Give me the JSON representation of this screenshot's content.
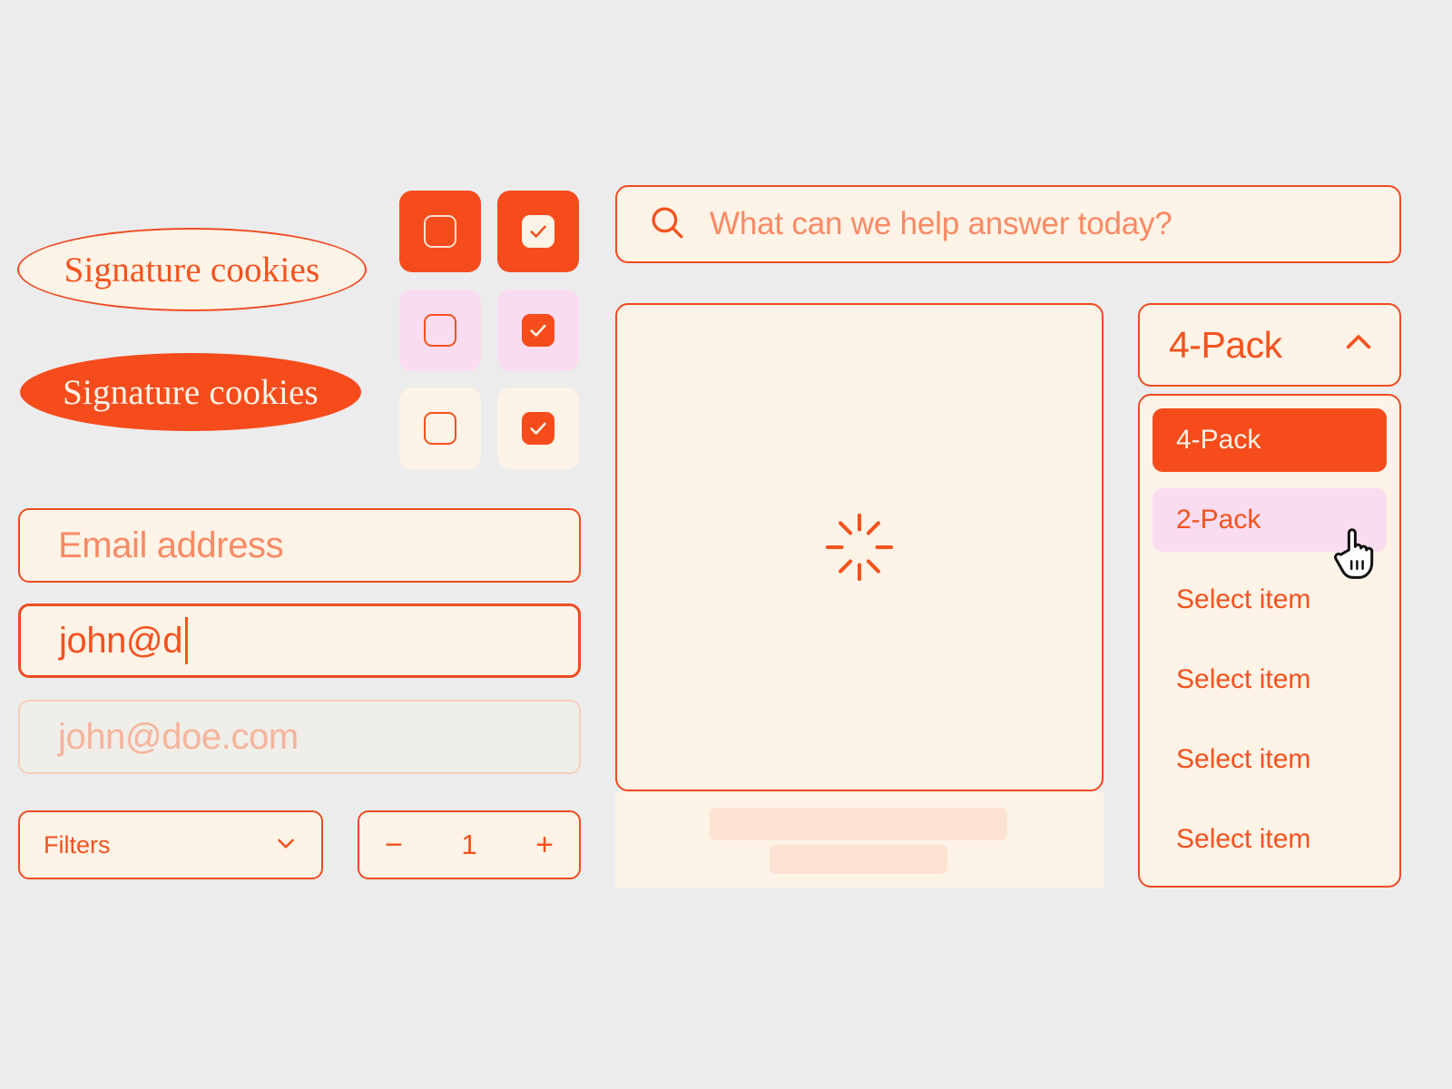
{
  "theme": {
    "page_background": "#ececec",
    "primary_orange": "#f64c1c",
    "border_orange": "#ef4b22",
    "text_orange": "#f4521e",
    "cream": "#fdf3e6",
    "pink": "#f9dcef",
    "placeholder_orange": "#f98a65",
    "disabled_background": "#efeee9",
    "disabled_text": "#f6b49c",
    "skeleton": "#fbe2d2"
  },
  "pills": [
    {
      "label": "Signature cookies",
      "style": "outline"
    },
    {
      "label": "Signature cookies",
      "style": "solid"
    }
  ],
  "checkbox_tiles": [
    {
      "tile": "orange",
      "checked": false,
      "icon": "checkbox-empty-icon"
    },
    {
      "tile": "orange",
      "checked": true,
      "icon": "checkbox-checked-icon"
    },
    {
      "tile": "pink",
      "checked": false,
      "icon": "checkbox-empty-icon"
    },
    {
      "tile": "pink",
      "checked": true,
      "icon": "checkbox-checked-icon"
    },
    {
      "tile": "cream",
      "checked": false,
      "icon": "checkbox-empty-icon"
    },
    {
      "tile": "cream",
      "checked": true,
      "icon": "checkbox-checked-icon"
    }
  ],
  "search": {
    "placeholder": "What can we help answer today?",
    "value": "",
    "icon": "search-icon"
  },
  "fields": {
    "placeholder_state": {
      "placeholder": "Email address",
      "value": ""
    },
    "active_state": {
      "value": "john@d",
      "caret": true
    },
    "disabled_state": {
      "value": "john@doe.com",
      "disabled": true
    }
  },
  "filters": {
    "label": "Filters",
    "icon": "chevron-down-icon"
  },
  "stepper": {
    "decrement_label": "−",
    "value": "1",
    "increment_label": "+"
  },
  "loading": {
    "spinner_icon": "spinner-icon",
    "skeleton_bars": 2
  },
  "dropdown": {
    "trigger": {
      "value": "4-Pack",
      "icon": "chevron-up-icon",
      "expanded": true
    },
    "options": [
      {
        "label": "4-Pack",
        "state": "selected"
      },
      {
        "label": "2-Pack",
        "state": "hovered"
      },
      {
        "label": "Select item",
        "state": "default"
      },
      {
        "label": "Select item",
        "state": "default"
      },
      {
        "label": "Select item",
        "state": "default"
      },
      {
        "label": "Select item",
        "state": "default"
      }
    ]
  },
  "cursor": {
    "icon": "pointer-hand-cursor"
  }
}
